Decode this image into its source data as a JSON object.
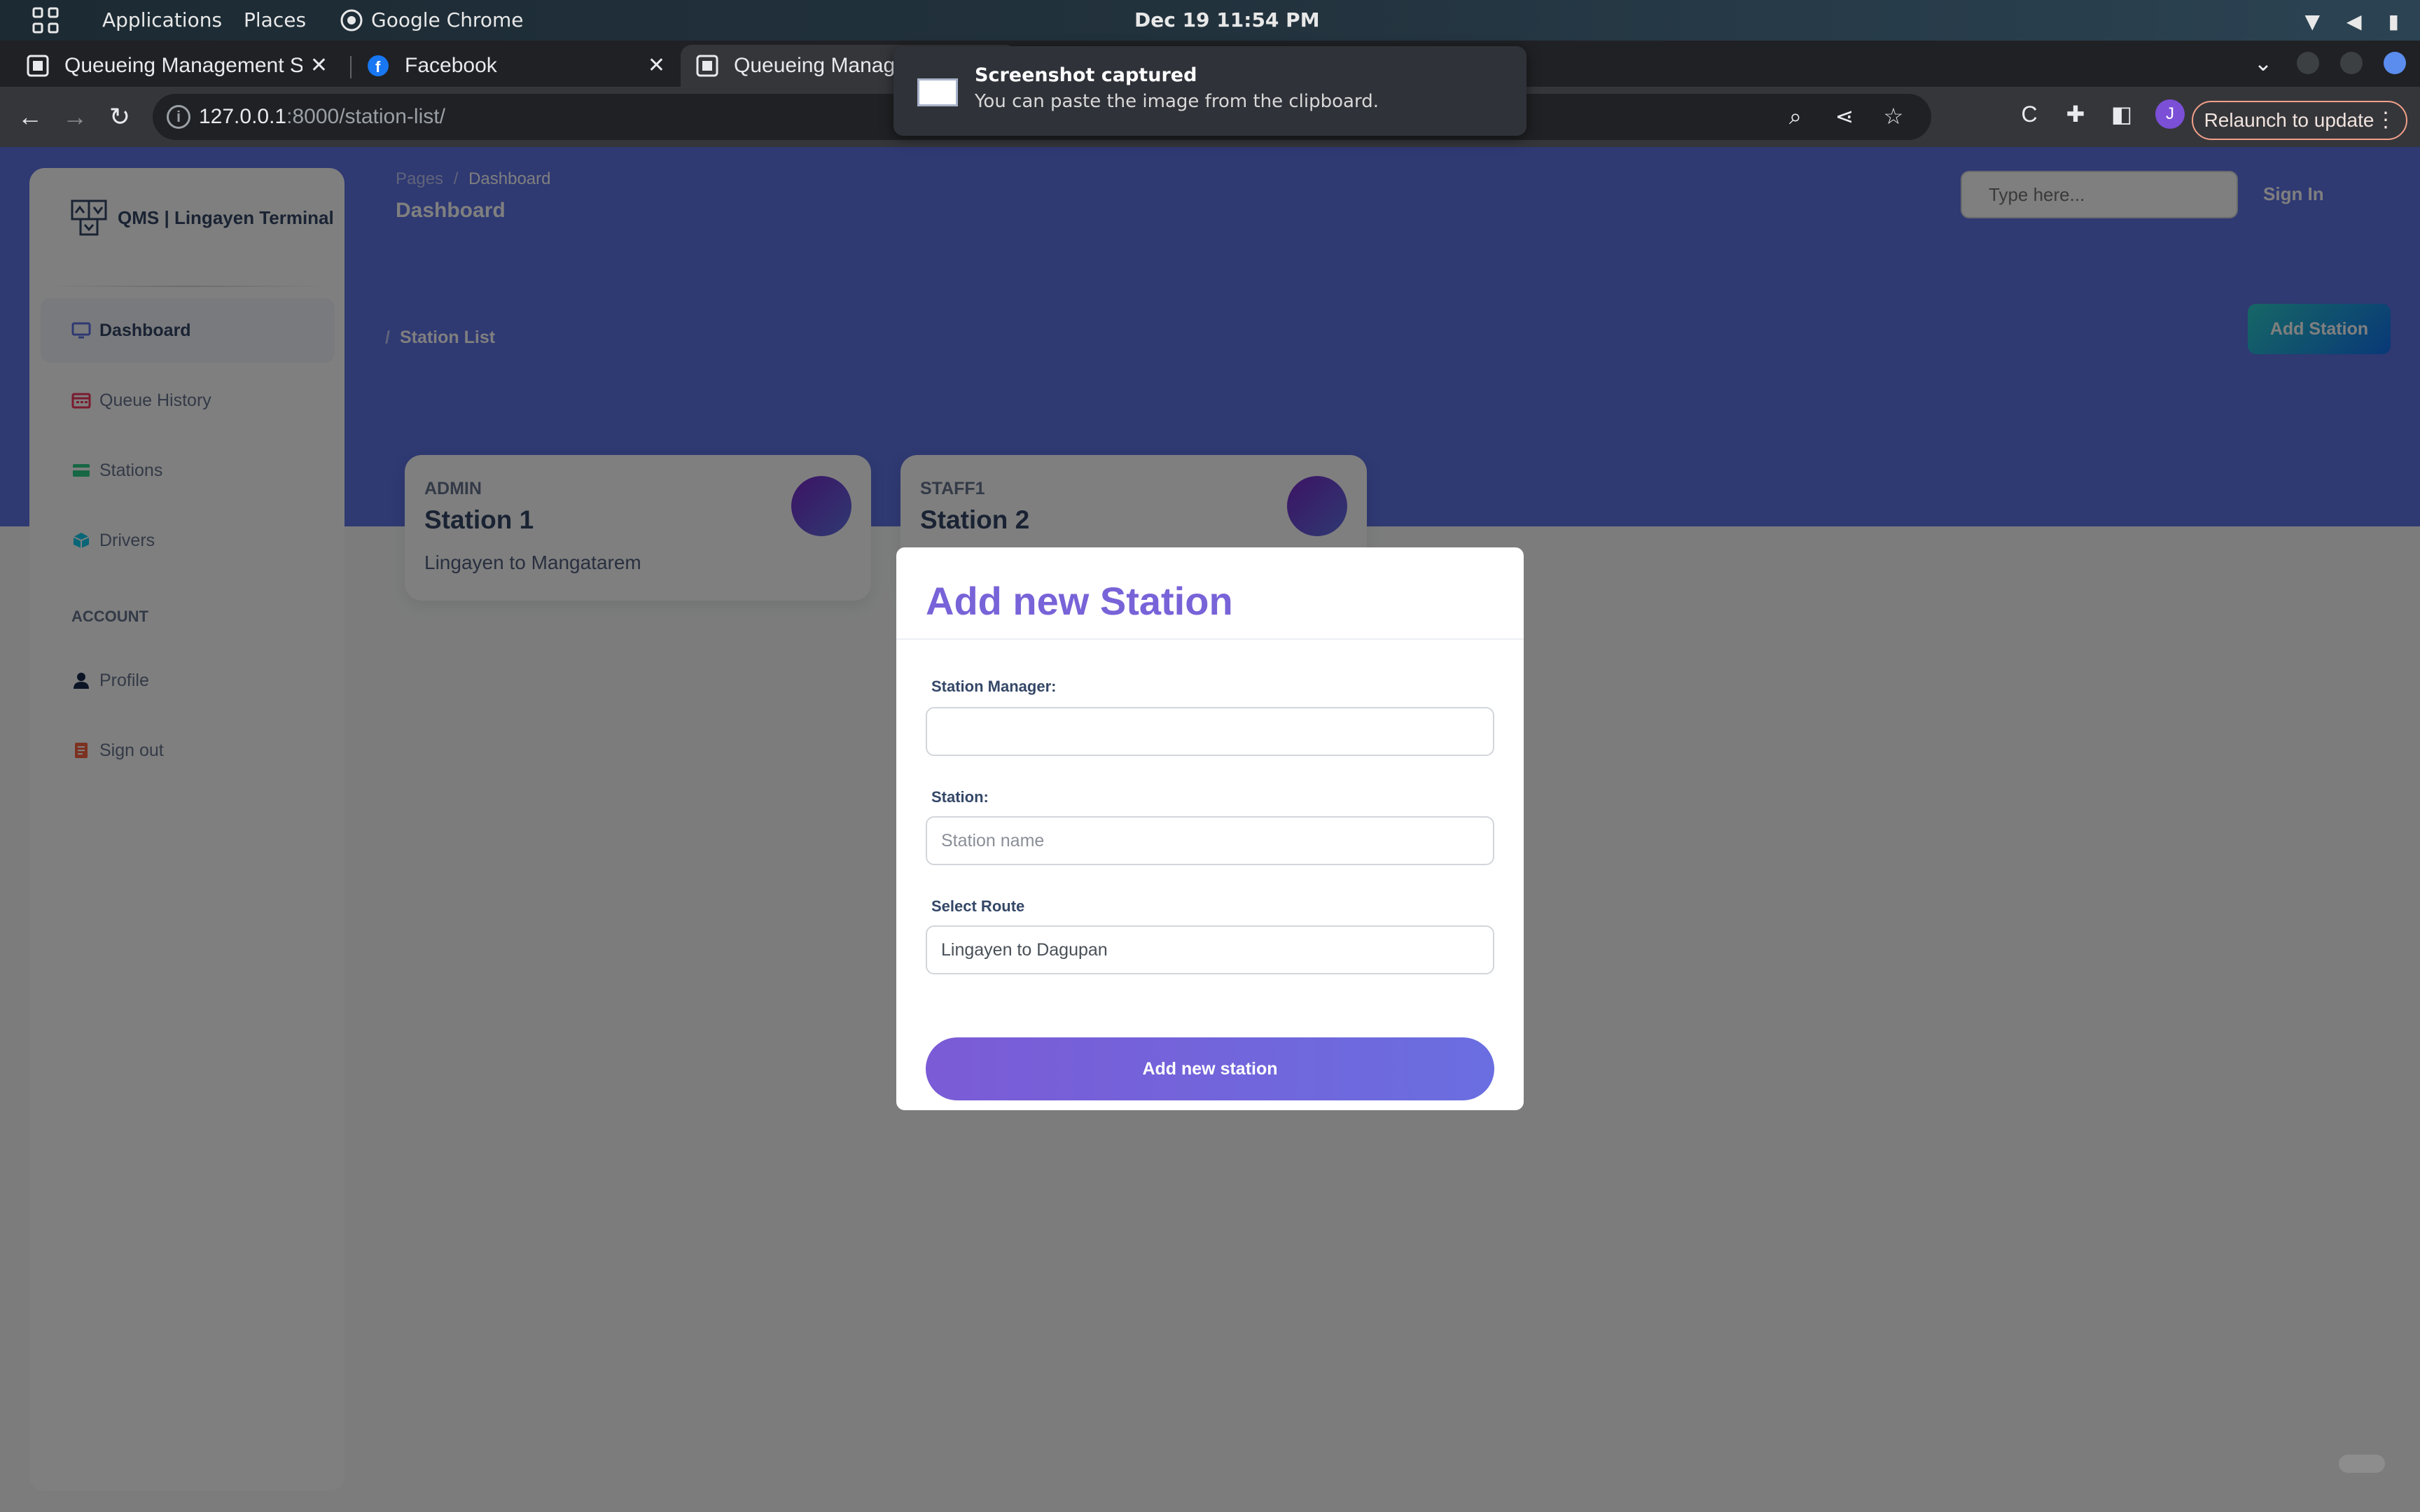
{
  "system": {
    "menu": [
      "Applications",
      "Places"
    ],
    "active_app": "Google Chrome",
    "clock": "Dec 19  11:54 PM"
  },
  "browser": {
    "tabs": [
      {
        "label": "Queueing Management S",
        "active": false
      },
      {
        "label": "Facebook",
        "active": false
      },
      {
        "label": "Queueing Manage",
        "active": true
      }
    ],
    "url_host": "127.0.0.1",
    "url_path": ":8000/station-list/",
    "profile_initial": "J",
    "relaunch_label": "Relaunch to update"
  },
  "notification": {
    "title": "Screenshot captured",
    "body": "You can paste the image from the clipboard."
  },
  "sidebar": {
    "brand": "QMS | Lingayen Terminal",
    "items": [
      {
        "label": "Dashboard",
        "icon": "monitor-icon",
        "color": "#5e72e4"
      },
      {
        "label": "Queue History",
        "icon": "calendar-icon",
        "color": "#f5365c"
      },
      {
        "label": "Stations",
        "icon": "credit-card-icon",
        "color": "#2dce89"
      },
      {
        "label": "Drivers",
        "icon": "box-icon",
        "color": "#11cdef"
      }
    ],
    "section_label": "ACCOUNT",
    "account_items": [
      {
        "label": "Profile",
        "icon": "user-icon",
        "color": "#172b4d"
      },
      {
        "label": "Sign out",
        "icon": "document-icon",
        "color": "#fb6340"
      }
    ]
  },
  "header": {
    "breadcrumb_root": "Pages",
    "breadcrumb_sep": "/",
    "breadcrumb_current": "Dashboard",
    "title": "Dashboard",
    "search_placeholder": "Type here...",
    "signin": "Sign In"
  },
  "content": {
    "sub_crumb_sep": "/",
    "sub_crumb": "Station List",
    "add_button": "Add Station",
    "stations": [
      {
        "user": "ADMIN",
        "name": "Station 1",
        "route": "Lingayen to Mangatarem"
      },
      {
        "user": "STAFF1",
        "name": "Station 2",
        "route": ""
      }
    ]
  },
  "modal": {
    "title": "Add new Station",
    "manager_label": "Station Manager:",
    "manager_value": "",
    "station_label": "Station:",
    "station_placeholder": "Station name",
    "route_label": "Select Route",
    "route_value": "Lingayen to Dagupan",
    "submit": "Add new station"
  },
  "colors": {
    "primary": "#5e72e4",
    "modal_accent": "#7863d8"
  }
}
